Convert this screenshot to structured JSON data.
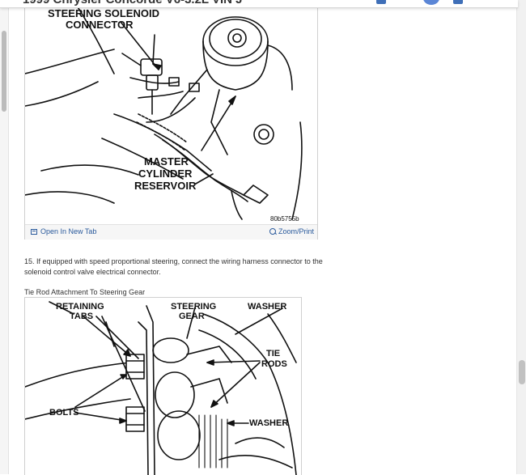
{
  "page": {
    "title": "1999 Chrysler Concorde V6-3.2L VIN J"
  },
  "figure1": {
    "labels": {
      "steering_solenoid": "STEERING SOLENOID",
      "connector": "CONNECTOR",
      "master": "MASTER",
      "cylinder": "CYLINDER",
      "reservoir": "RESERVOIR"
    },
    "code": "80b5755b",
    "open_in_new_tab": "Open In New Tab",
    "zoom_print": "Zoom/Print"
  },
  "step": {
    "text": "15. If equipped with speed proportional steering, connect the wiring harness connector to the solenoid control valve electrical connector."
  },
  "figure2": {
    "caption": "Tie Rod Attachment To Steering Gear",
    "labels": {
      "retaining": "RETAINING",
      "tabs": "TABS",
      "steering": "STEERING",
      "gear": "GEAR",
      "washer_top": "WASHER",
      "tie": "TIE",
      "rods": "RODS",
      "bolts": "BOLTS",
      "washer_bottom": "WASHER"
    }
  },
  "icons": {
    "open": "open-in-new-tab-icon",
    "zoom": "zoom-icon"
  }
}
